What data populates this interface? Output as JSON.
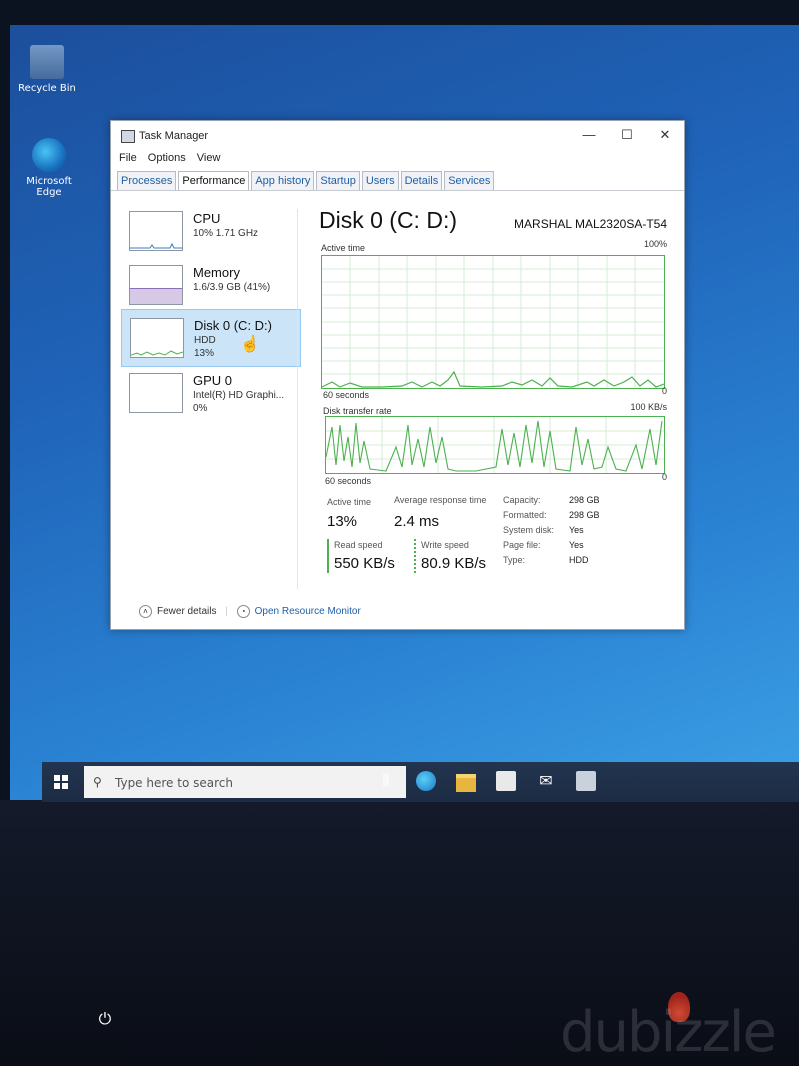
{
  "desktop": {
    "icons": [
      {
        "label": "Recycle Bin"
      },
      {
        "label": "Microsoft Edge"
      }
    ]
  },
  "window": {
    "title": "Task Manager",
    "controls": {
      "minimize": "—",
      "maximize": "☐",
      "close": "✕"
    },
    "menu": [
      "File",
      "Options",
      "View"
    ],
    "tabs": [
      "Processes",
      "Performance",
      "App history",
      "Startup",
      "Users",
      "Details",
      "Services"
    ],
    "active_tab": "Performance"
  },
  "sidebar": {
    "items": [
      {
        "name": "CPU",
        "line1": "10% 1.71 GHz",
        "line2": ""
      },
      {
        "name": "Memory",
        "line1": "1.6/3.9 GB (41%)",
        "line2": ""
      },
      {
        "name": "Disk 0 (C: D:)",
        "line1": "HDD",
        "line2": "13%"
      },
      {
        "name": "GPU 0",
        "line1": "Intel(R) HD Graphi...",
        "line2": "0%"
      }
    ],
    "selected_index": 2
  },
  "detail": {
    "title": "Disk 0 (C: D:)",
    "model": "MARSHAL MAL2320SA-T54",
    "graph1": {
      "label": "Active time",
      "max": "100%",
      "min": "0",
      "span": "60 seconds"
    },
    "graph2": {
      "label": "Disk transfer rate",
      "max": "100 KB/s",
      "min": "0",
      "span": "60 seconds"
    },
    "stats": {
      "active_time": {
        "label": "Active time",
        "value": "13%"
      },
      "avg_response": {
        "label": "Average response time",
        "value": "2.4 ms"
      },
      "read_speed": {
        "label": "Read speed",
        "value": "550 KB/s"
      },
      "write_speed": {
        "label": "Write speed",
        "value": "80.9 KB/s"
      }
    },
    "properties": [
      {
        "key": "Capacity:",
        "value": "298 GB"
      },
      {
        "key": "Formatted:",
        "value": "298 GB"
      },
      {
        "key": "System disk:",
        "value": "Yes"
      },
      {
        "key": "Page file:",
        "value": "Yes"
      },
      {
        "key": "Type:",
        "value": "HDD"
      }
    ]
  },
  "footer": {
    "fewer_details": "Fewer details",
    "open_resource_monitor": "Open Resource Monitor"
  },
  "taskbar": {
    "search_placeholder": "Type here to search",
    "pinned": [
      "task-view-icon",
      "edge-icon",
      "file-explorer-icon",
      "store-icon",
      "mail-icon",
      "photos-icon"
    ]
  },
  "colors": {
    "graph_green": "#4db150",
    "selected_bg": "#cce4f7",
    "link_blue": "#1f5fa8"
  },
  "watermark": "dubizzle"
}
